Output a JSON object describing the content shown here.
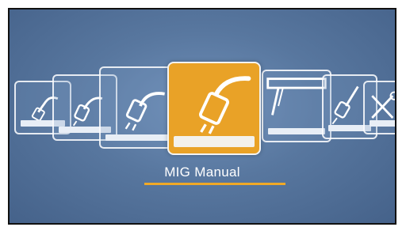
{
  "mode_selector": {
    "selected_mode_label": "MIG Manual",
    "accent_color": "#e9a227",
    "items": [
      {
        "icon": "mig-torch-icon"
      },
      {
        "icon": "mig-torch-icon"
      },
      {
        "icon": "mig-torch-icon"
      },
      {
        "icon": "mig-torch-icon"
      },
      {
        "icon": "mig-manual-torch-icon",
        "selected": true
      },
      {
        "icon": "tig-torch-icon"
      },
      {
        "icon": "stick-electrode-icon"
      },
      {
        "icon": "tools-settings-icon"
      }
    ]
  }
}
